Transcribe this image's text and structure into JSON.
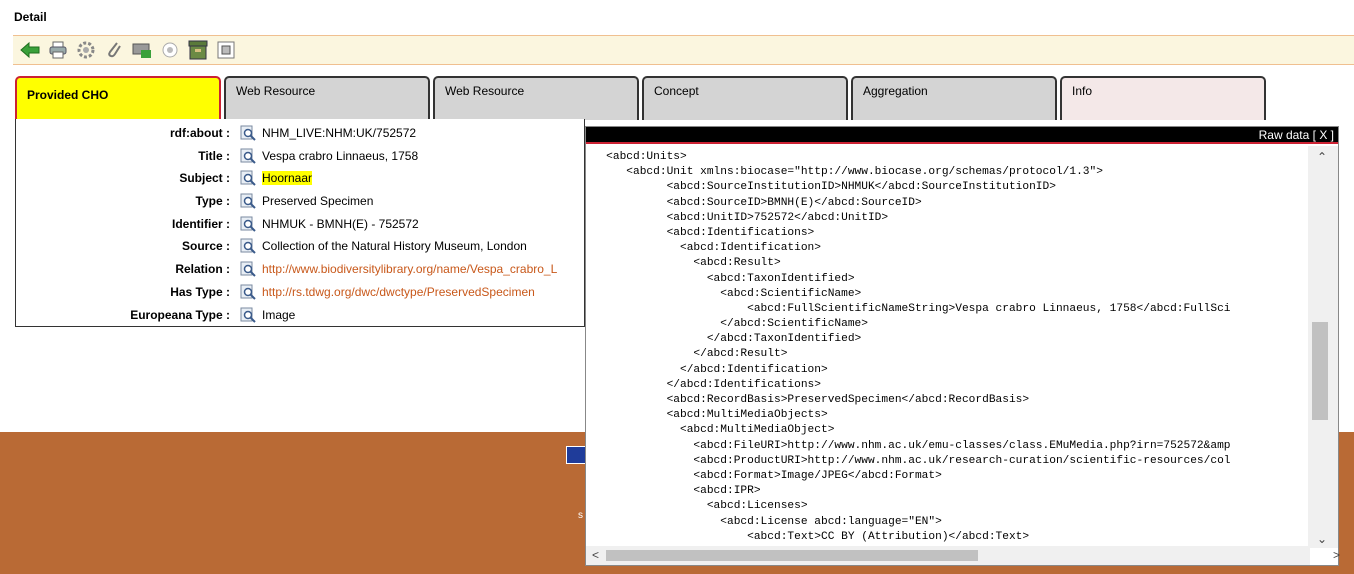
{
  "page": {
    "title": "Detail"
  },
  "toolbar": {
    "buttons": [
      {
        "name": "back-icon"
      },
      {
        "name": "print-icon"
      },
      {
        "name": "settings-icon"
      },
      {
        "name": "attach-icon"
      },
      {
        "name": "cart-icon"
      },
      {
        "name": "radio-icon"
      },
      {
        "name": "archive-icon"
      },
      {
        "name": "document-icon"
      }
    ]
  },
  "tabs": [
    {
      "label": "Provided CHO"
    },
    {
      "label": "Web Resource"
    },
    {
      "label": "Web Resource"
    },
    {
      "label": "Concept"
    },
    {
      "label": "Aggregation"
    },
    {
      "label": "Info"
    }
  ],
  "fields": [
    {
      "label": "rdf:about :",
      "value": "NHM_LIVE:NHM:UK/752572"
    },
    {
      "label": "Title :",
      "value": "Vespa crabro Linnaeus, 1758"
    },
    {
      "label": "Subject :",
      "value": "Hoornaar"
    },
    {
      "label": "Type :",
      "value": "Preserved Specimen"
    },
    {
      "label": "Identifier :",
      "value": "NHMUK - BMNH(E) - 752572"
    },
    {
      "label": "Source :",
      "value": "Collection of the Natural History Museum, London"
    },
    {
      "label": "Relation :",
      "value": "http://www.biodiversitylibrary.org/name/Vespa_crabro_L"
    },
    {
      "label": "Has Type :",
      "value": "http://rs.tdwg.org/dwc/dwctype/PreservedSpecimen"
    },
    {
      "label": "Europeana Type :",
      "value": "Image"
    }
  ],
  "raw_data": {
    "title": "Raw data",
    "close_label": "[ X ]",
    "lines": [
      "   <abcd:Units>",
      "      <abcd:Unit xmlns:biocase=\"http://www.biocase.org/schemas/protocol/1.3\">",
      "            <abcd:SourceInstitutionID>NHMUK</abcd:SourceInstitutionID>",
      "            <abcd:SourceID>BMNH(E)</abcd:SourceID>",
      "            <abcd:UnitID>752572</abcd:UnitID>",
      "            <abcd:Identifications>",
      "              <abcd:Identification>",
      "                <abcd:Result>",
      "                  <abcd:TaxonIdentified>",
      "                    <abcd:ScientificName>",
      "                        <abcd:FullScientificNameString>Vespa crabro Linnaeus, 1758</abcd:FullSci",
      "                    </abcd:ScientificName>",
      "                  </abcd:TaxonIdentified>",
      "                </abcd:Result>",
      "              </abcd:Identification>",
      "            </abcd:Identifications>",
      "            <abcd:RecordBasis>PreservedSpecimen</abcd:RecordBasis>",
      "            <abcd:MultiMediaObjects>",
      "              <abcd:MultiMediaObject>",
      "                <abcd:FileURI>http://www.nhm.ac.uk/emu-classes/class.EMuMedia.php?irn=752572&amp",
      "                <abcd:ProductURI>http://www.nhm.ac.uk/research-curation/scientific-resources/col",
      "                <abcd:Format>Image/JPEG</abcd:Format>",
      "                <abcd:IPR>",
      "                  <abcd:Licenses>",
      "                    <abcd:License abcd:language=\"EN\">",
      "                        <abcd:Text>CC BY (Attribution)</abcd:Text>"
    ]
  },
  "footer": {
    "fragment": "s"
  },
  "colors": {
    "active_tab": "#ffff00",
    "active_tab_border": "#cc2233",
    "link": "#c8581a",
    "footer": "#b96a35",
    "toolbar_bg": "#fbf6df"
  }
}
